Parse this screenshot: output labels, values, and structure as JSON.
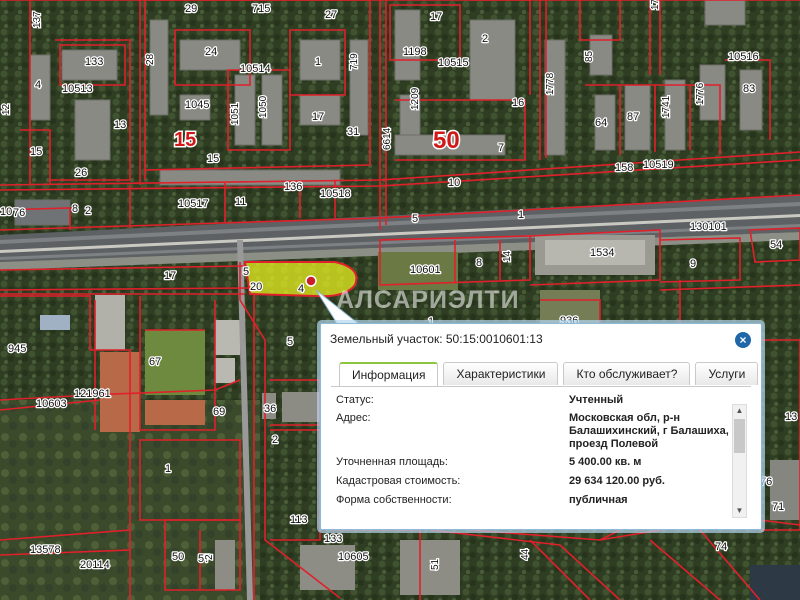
{
  "map": {
    "watermark": "АЛСАРИЭЛТИ",
    "labels": [
      {
        "t": "29"
      },
      {
        "t": "715"
      },
      {
        "t": "27"
      },
      {
        "t": "137"
      },
      {
        "t": "17"
      },
      {
        "t": "1736"
      },
      {
        "t": "133"
      },
      {
        "t": "24"
      },
      {
        "t": "2"
      },
      {
        "t": "10514"
      },
      {
        "t": "28"
      },
      {
        "t": "1"
      },
      {
        "t": "719"
      },
      {
        "t": "1198"
      },
      {
        "t": "10515"
      },
      {
        "t": "85"
      },
      {
        "t": "10516"
      },
      {
        "t": "4"
      },
      {
        "t": "10513"
      },
      {
        "t": "1045"
      },
      {
        "t": "1051"
      },
      {
        "t": "1050"
      },
      {
        "t": "1778"
      },
      {
        "t": "83"
      },
      {
        "t": "12"
      },
      {
        "t": "13"
      },
      {
        "t": "15"
      },
      {
        "t": "17"
      },
      {
        "t": "31"
      },
      {
        "t": "1209"
      },
      {
        "t": "16"
      },
      {
        "t": "64"
      },
      {
        "t": "87"
      },
      {
        "t": "1741"
      },
      {
        "t": "1776"
      },
      {
        "t": "15"
      },
      {
        "t": "26"
      },
      {
        "t": "6614"
      },
      {
        "t": "7"
      },
      {
        "t": "158"
      },
      {
        "t": "10519"
      },
      {
        "t": "136"
      },
      {
        "t": "10"
      },
      {
        "t": "10"
      },
      {
        "t": "76"
      },
      {
        "t": "8"
      },
      {
        "t": "2"
      },
      {
        "t": "10517"
      },
      {
        "t": "11"
      },
      {
        "t": "10518"
      },
      {
        "t": "5"
      },
      {
        "t": "1"
      },
      {
        "t": "130101"
      },
      {
        "t": "54"
      },
      {
        "t": "1534"
      },
      {
        "t": "17"
      },
      {
        "t": "5"
      },
      {
        "t": "10601"
      },
      {
        "t": "8"
      },
      {
        "t": "14"
      },
      {
        "t": "9"
      },
      {
        "t": "20"
      },
      {
        "t": "4"
      },
      {
        "t": "1"
      },
      {
        "t": "936"
      },
      {
        "t": "945"
      },
      {
        "t": "5"
      },
      {
        "t": "67"
      },
      {
        "t": "121961"
      },
      {
        "t": "10603"
      },
      {
        "t": "69"
      },
      {
        "t": "36"
      },
      {
        "t": "2"
      },
      {
        "t": "1"
      },
      {
        "t": "113"
      },
      {
        "t": "50"
      },
      {
        "t": "57"
      },
      {
        "t": "2"
      },
      {
        "t": "13578"
      },
      {
        "t": "20114"
      },
      {
        "t": "133"
      },
      {
        "t": "10605"
      },
      {
        "t": "51"
      },
      {
        "t": "44"
      },
      {
        "t": "74"
      },
      {
        "t": "76"
      },
      {
        "t": "71"
      },
      {
        "t": "13"
      },
      {
        "t": "7"
      }
    ],
    "big_labels": [
      {
        "t": "50"
      },
      {
        "t": "15"
      }
    ]
  },
  "popup": {
    "title": "Земельный участок: 50:15:0010601:13",
    "close_symbol": "×",
    "tabs": [
      {
        "label": "Информация",
        "active": true
      },
      {
        "label": "Характеристики",
        "active": false
      },
      {
        "label": "Кто обслуживает?",
        "active": false
      },
      {
        "label": "Услуги",
        "active": false
      }
    ],
    "rows": [
      {
        "key": "Статус:",
        "value": "Учтенный"
      },
      {
        "key": "Адрес:",
        "value": "Московская обл, р-н Балашихинский, г Балашиха, проезд Полевой"
      },
      {
        "key": "Уточненная площадь:",
        "value": "5 400.00 кв. м"
      },
      {
        "key": "Кадастровая стоимость:",
        "value": "29 634 120.00 руб."
      },
      {
        "key": "Форма собственности:",
        "value": "публичная"
      }
    ]
  },
  "colors": {
    "parcel_line": "#e0202a",
    "highlight": "#e8f020",
    "accent_tab": "#8cc63f",
    "close_btn": "#1f67a8"
  }
}
